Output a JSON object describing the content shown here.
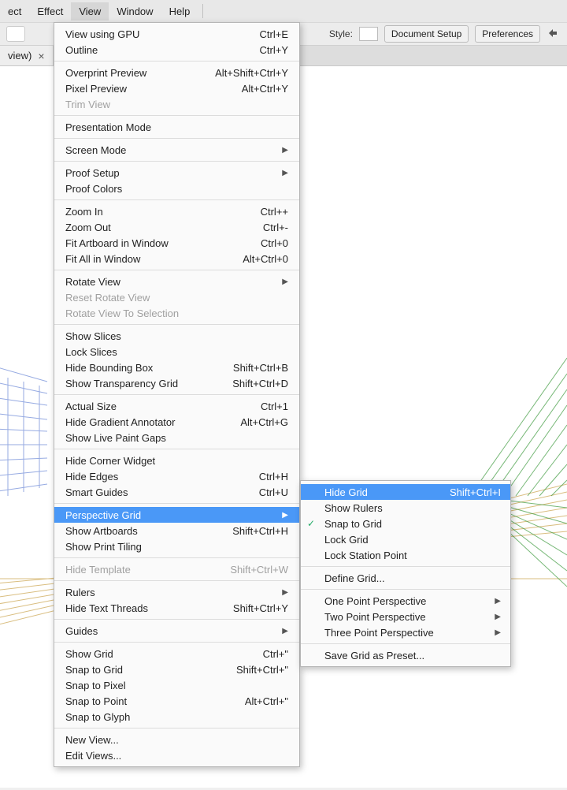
{
  "menubar": {
    "items": [
      "ect",
      "Effect",
      "View",
      "Window",
      "Help"
    ],
    "active_index": 2
  },
  "toolbar": {
    "style_label": "Style:",
    "document_setup": "Document Setup",
    "preferences": "Preferences"
  },
  "tab": {
    "title": "view)",
    "close": "×"
  },
  "menu": {
    "items": [
      {
        "label": "View using GPU",
        "shortcut": "Ctrl+E"
      },
      {
        "label": "Outline",
        "shortcut": "Ctrl+Y"
      },
      {
        "sep": true
      },
      {
        "label": "Overprint Preview",
        "shortcut": "Alt+Shift+Ctrl+Y"
      },
      {
        "label": "Pixel Preview",
        "shortcut": "Alt+Ctrl+Y"
      },
      {
        "label": "Trim View",
        "disabled": true
      },
      {
        "sep": true
      },
      {
        "label": "Presentation Mode"
      },
      {
        "sep": true
      },
      {
        "label": "Screen Mode",
        "submenu": true
      },
      {
        "sep": true
      },
      {
        "label": "Proof Setup",
        "submenu": true
      },
      {
        "label": "Proof Colors"
      },
      {
        "sep": true
      },
      {
        "label": "Zoom In",
        "shortcut": "Ctrl++"
      },
      {
        "label": "Zoom Out",
        "shortcut": "Ctrl+-"
      },
      {
        "label": "Fit Artboard in Window",
        "shortcut": "Ctrl+0"
      },
      {
        "label": "Fit All in Window",
        "shortcut": "Alt+Ctrl+0"
      },
      {
        "sep": true
      },
      {
        "label": "Rotate View",
        "submenu": true
      },
      {
        "label": "Reset Rotate View",
        "disabled": true
      },
      {
        "label": "Rotate View To Selection",
        "disabled": true
      },
      {
        "sep": true
      },
      {
        "label": "Show Slices"
      },
      {
        "label": "Lock Slices"
      },
      {
        "label": "Hide Bounding Box",
        "shortcut": "Shift+Ctrl+B"
      },
      {
        "label": "Show Transparency Grid",
        "shortcut": "Shift+Ctrl+D"
      },
      {
        "sep": true
      },
      {
        "label": "Actual Size",
        "shortcut": "Ctrl+1"
      },
      {
        "label": "Hide Gradient Annotator",
        "shortcut": "Alt+Ctrl+G"
      },
      {
        "label": "Show Live Paint Gaps"
      },
      {
        "sep": true
      },
      {
        "label": "Hide Corner Widget"
      },
      {
        "label": "Hide Edges",
        "shortcut": "Ctrl+H"
      },
      {
        "label": "Smart Guides",
        "shortcut": "Ctrl+U"
      },
      {
        "sep": true
      },
      {
        "label": "Perspective Grid",
        "submenu": true,
        "selected": true
      },
      {
        "label": "Show Artboards",
        "shortcut": "Shift+Ctrl+H"
      },
      {
        "label": "Show Print Tiling"
      },
      {
        "sep": true
      },
      {
        "label": "Hide Template",
        "shortcut": "Shift+Ctrl+W",
        "disabled": true
      },
      {
        "sep": true
      },
      {
        "label": "Rulers",
        "submenu": true
      },
      {
        "label": "Hide Text Threads",
        "shortcut": "Shift+Ctrl+Y"
      },
      {
        "sep": true
      },
      {
        "label": "Guides",
        "submenu": true
      },
      {
        "sep": true
      },
      {
        "label": "Show Grid",
        "shortcut": "Ctrl+\""
      },
      {
        "label": "Snap to Grid",
        "shortcut": "Shift+Ctrl+\""
      },
      {
        "label": "Snap to Pixel"
      },
      {
        "label": "Snap to Point",
        "shortcut": "Alt+Ctrl+\""
      },
      {
        "label": "Snap to Glyph"
      },
      {
        "sep": true
      },
      {
        "label": "New View..."
      },
      {
        "label": "Edit Views..."
      }
    ]
  },
  "submenu": {
    "items": [
      {
        "label": "Hide Grid",
        "shortcut": "Shift+Ctrl+I",
        "selected": true
      },
      {
        "label": "Show Rulers"
      },
      {
        "label": "Snap to Grid",
        "checked": true
      },
      {
        "label": "Lock Grid"
      },
      {
        "label": "Lock Station Point"
      },
      {
        "sep": true
      },
      {
        "label": "Define Grid..."
      },
      {
        "sep": true
      },
      {
        "label": "One Point Perspective",
        "submenu": true
      },
      {
        "label": "Two Point Perspective",
        "submenu": true
      },
      {
        "label": "Three Point Perspective",
        "submenu": true
      },
      {
        "sep": true
      },
      {
        "label": "Save Grid as Preset..."
      }
    ]
  }
}
